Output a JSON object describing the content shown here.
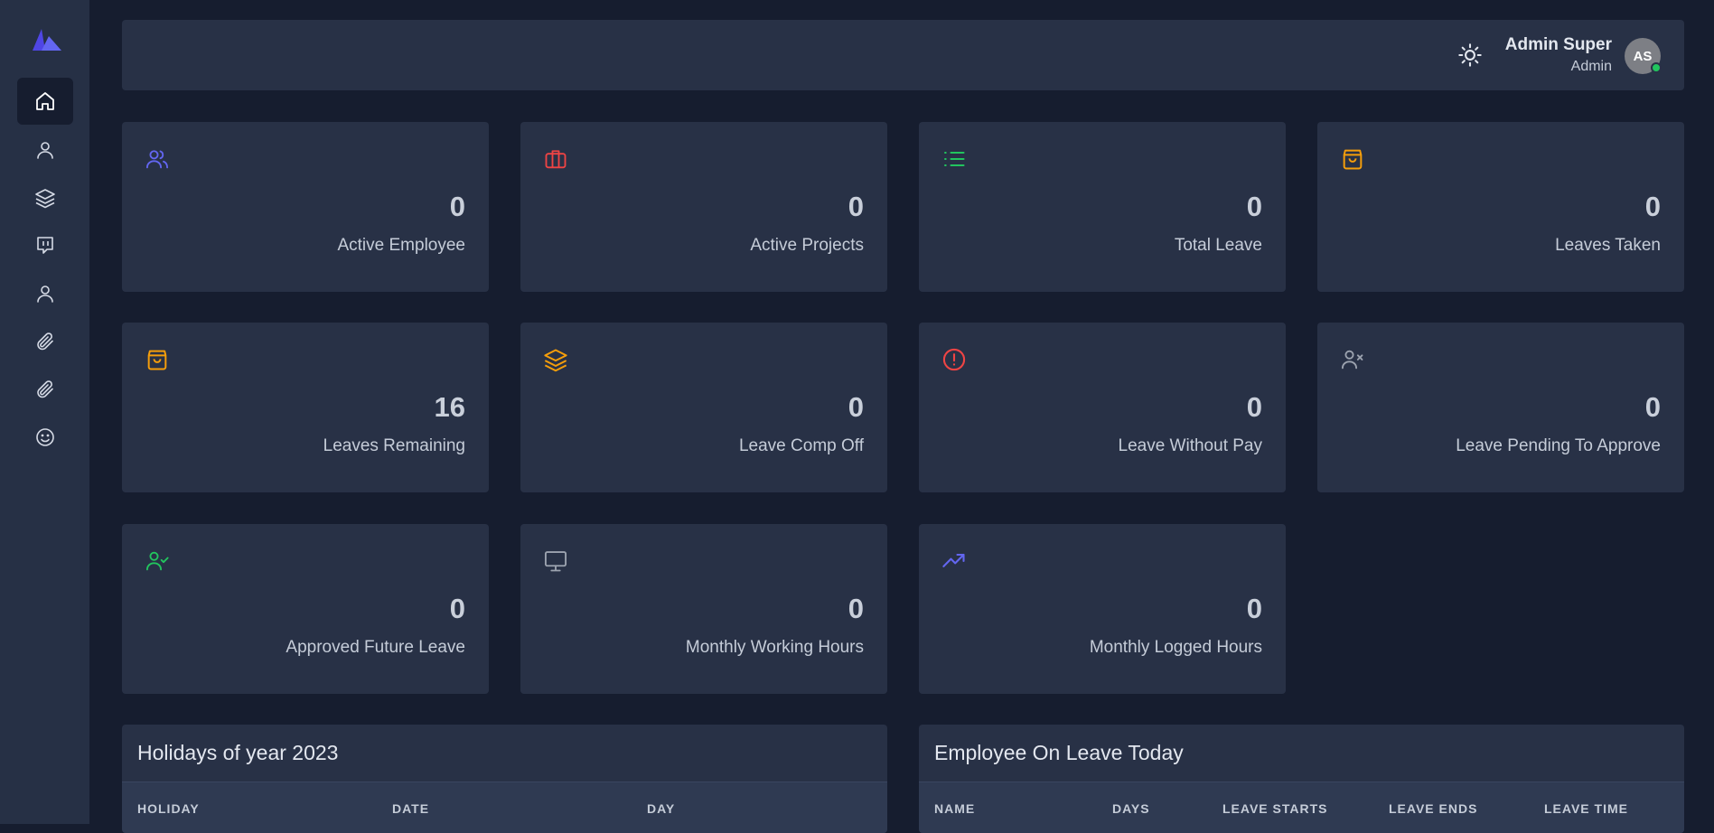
{
  "header": {
    "user_name": "Admin Super",
    "user_role": "Admin",
    "avatar_initials": "AS"
  },
  "colors": {
    "indigo": "#6366f1",
    "red": "#ef4444",
    "green": "#22c55e",
    "orange": "#f59e0b",
    "gray": "#9ca3af"
  },
  "stats": [
    {
      "icon": "users-icon",
      "value": "0",
      "label": "Active Employee"
    },
    {
      "icon": "briefcase-icon",
      "value": "0",
      "label": "Active Projects"
    },
    {
      "icon": "list-icon",
      "value": "0",
      "label": "Total Leave"
    },
    {
      "icon": "shopping-bag-icon",
      "value": "0",
      "label": "Leaves Taken"
    },
    {
      "icon": "shopping-bag-icon",
      "value": "16",
      "label": "Leaves Remaining"
    },
    {
      "icon": "layers-icon",
      "value": "0",
      "label": "Leave Comp Off"
    },
    {
      "icon": "alert-circle-icon",
      "value": "0",
      "label": "Leave Without Pay"
    },
    {
      "icon": "user-x-icon",
      "value": "0",
      "label": "Leave Pending To Approve"
    },
    {
      "icon": "user-check-icon",
      "value": "0",
      "label": "Approved Future Leave"
    },
    {
      "icon": "monitor-icon",
      "value": "0",
      "label": "Monthly Working Hours"
    },
    {
      "icon": "trending-up-icon",
      "value": "0",
      "label": "Monthly Logged Hours"
    }
  ],
  "holidays": {
    "title": "Holidays of year 2023",
    "columns": [
      "HOLIDAY",
      "DATE",
      "DAY"
    ]
  },
  "on_leave": {
    "title": "Employee On Leave Today",
    "columns": [
      "NAME",
      "DAYS",
      "LEAVE STARTS",
      "LEAVE ENDS",
      "LEAVE TIME"
    ]
  }
}
